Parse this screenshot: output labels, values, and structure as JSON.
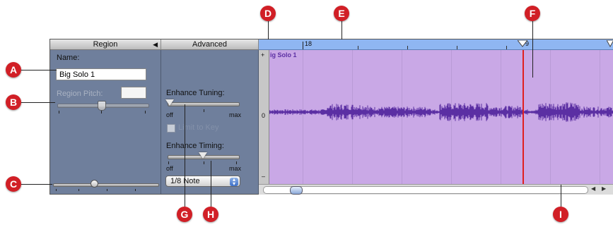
{
  "callouts": [
    "A",
    "B",
    "C",
    "D",
    "E",
    "F",
    "G",
    "H",
    "I"
  ],
  "header": {
    "region_tab": "Region",
    "region_collapse_glyph": "◀",
    "advanced_tab": "Advanced"
  },
  "region": {
    "name_label": "Name:",
    "name_value": "Big Solo 1",
    "pitch_label": "Region Pitch:",
    "pitch_value": ""
  },
  "advanced": {
    "enhance_tuning_label": "Enhance Tuning:",
    "tuning_min": "off",
    "tuning_max": "max",
    "tuning_level": 0.0,
    "limit_checkbox_label": "Limit to Key",
    "enhance_timing_label": "Enhance Timing:",
    "timing_min": "off",
    "timing_max": "max",
    "timing_level": 0.45,
    "note_value": "1/8 Note"
  },
  "editor": {
    "ruler_mark_1": "18",
    "ruler_mark_2": "9",
    "region_name": "ig Solo 1",
    "scale_plus": "+",
    "scale_zero": "0",
    "scale_minus": "–"
  },
  "scroll": {
    "left_arrow": "◀",
    "right_arrow": "▶"
  },
  "colors": {
    "callout": "#d11f26",
    "region_bg": "#c9a8e6",
    "waveform": "#5b2fa3",
    "playhead": "#e02020",
    "ruler": "#8fb6f2",
    "panel": "#6f7f9c"
  },
  "icons": {
    "collapse": "triangle-left-icon",
    "playhead": "playhead-triangle-icon",
    "popup": "updown-arrows-icon"
  }
}
